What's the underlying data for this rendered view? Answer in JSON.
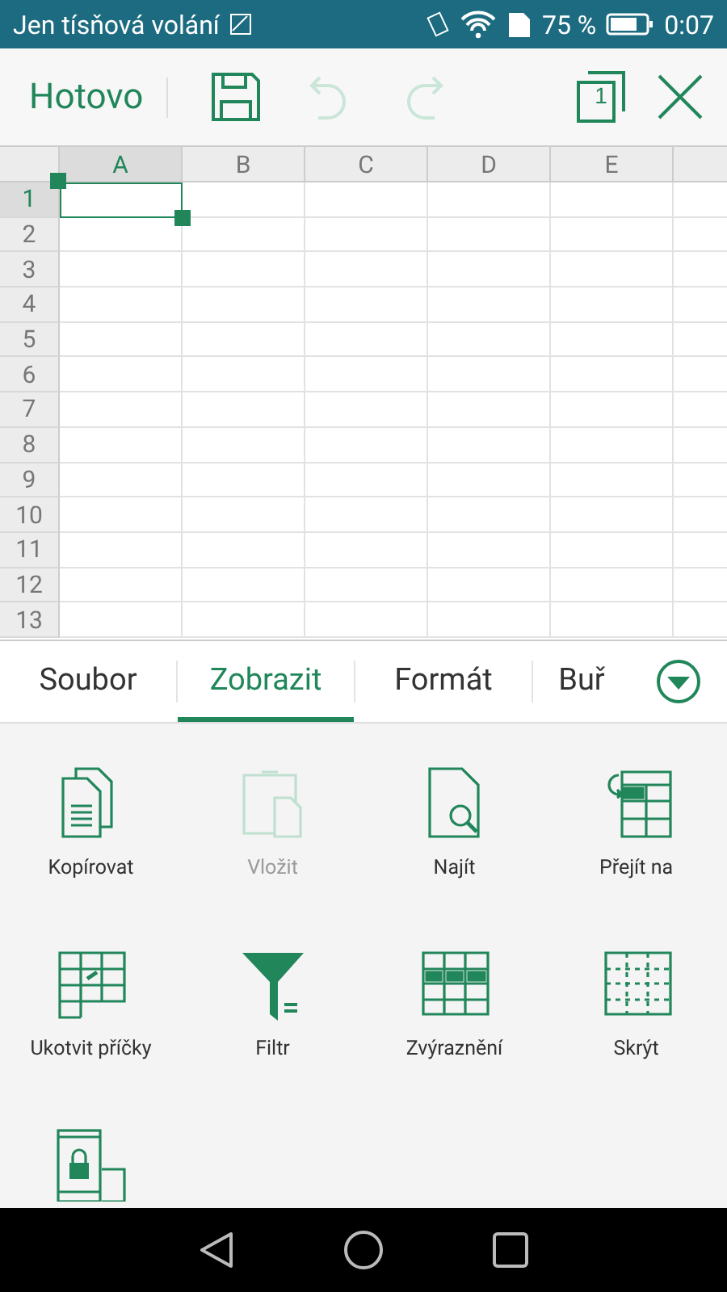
{
  "status_bar": {
    "notice": "Jen tísňová volání",
    "battery": "75 %",
    "time": "0:07"
  },
  "toolbar": {
    "done": "Hotovo",
    "undo_disabled": true,
    "redo_disabled": true,
    "sheet_count": "1"
  },
  "sheet": {
    "columns": [
      {
        "label": "A",
        "selected": true
      },
      {
        "label": "B",
        "selected": false
      },
      {
        "label": "C",
        "selected": false
      },
      {
        "label": "D",
        "selected": false
      },
      {
        "label": "E",
        "selected": false
      }
    ],
    "rows": [
      {
        "label": "1",
        "selected": true
      },
      {
        "label": "2",
        "selected": false
      },
      {
        "label": "3",
        "selected": false
      },
      {
        "label": "4",
        "selected": false
      },
      {
        "label": "5",
        "selected": false
      },
      {
        "label": "6",
        "selected": false
      },
      {
        "label": "7",
        "selected": false
      },
      {
        "label": "8",
        "selected": false
      },
      {
        "label": "9",
        "selected": false
      },
      {
        "label": "10",
        "selected": false
      },
      {
        "label": "11",
        "selected": false
      },
      {
        "label": "12",
        "selected": false
      },
      {
        "label": "13",
        "selected": false
      }
    ]
  },
  "tabs": [
    {
      "label": "Soubor",
      "selected": false
    },
    {
      "label": "Zobrazit",
      "selected": true
    },
    {
      "label": "Formát",
      "selected": false
    },
    {
      "label": "Buř",
      "selected": false
    }
  ],
  "tools": [
    {
      "kind": "copy",
      "label": "Kopírovat",
      "disabled": false
    },
    {
      "kind": "paste",
      "label": "Vložit",
      "disabled": true
    },
    {
      "kind": "find",
      "label": "Najít",
      "disabled": false
    },
    {
      "kind": "goto",
      "label": "Přejít na",
      "disabled": false
    },
    {
      "kind": "freeze",
      "label": "Ukotvit příčky",
      "disabled": false
    },
    {
      "kind": "filter",
      "label": "Filtr",
      "disabled": false
    },
    {
      "kind": "highlight",
      "label": "Zvýraznění",
      "disabled": false
    },
    {
      "kind": "hide",
      "label": "Skrýt",
      "disabled": false
    },
    {
      "kind": "lock",
      "disabled": false
    }
  ]
}
